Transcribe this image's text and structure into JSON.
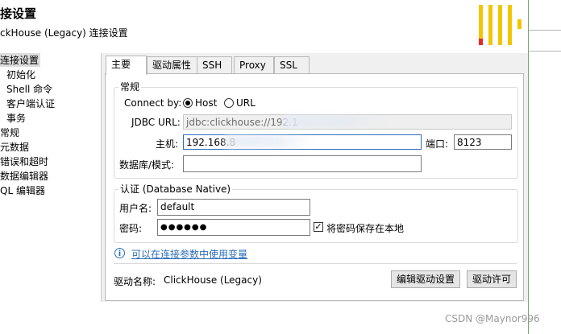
{
  "header": {
    "title": "接设置",
    "subtitle": "ckHouse (Legacy) 连接设置",
    "colors": {
      "logo_yellow": "#f3c500",
      "logo_red": "#e8262a"
    }
  },
  "tree": {
    "items": [
      {
        "label": "连接设置",
        "selected": true
      },
      {
        "label": "初始化"
      },
      {
        "label": "Shell 命令"
      },
      {
        "label": "客户端认证"
      },
      {
        "label": "事务"
      },
      {
        "label": "常规"
      },
      {
        "label": "元数据"
      },
      {
        "label": "错误和超时"
      },
      {
        "label": "数据编辑器"
      },
      {
        "label": "QL 编辑器"
      }
    ]
  },
  "tabs": [
    {
      "label": "主要",
      "active": true
    },
    {
      "label": "驱动属性"
    },
    {
      "label": "SSH"
    },
    {
      "label": "Proxy"
    },
    {
      "label": "SSL"
    }
  ],
  "general": {
    "group_label": "常规",
    "connect_by_label": "Connect by:",
    "host_option": "Host",
    "url_option": "URL",
    "jdbc_label": "JDBC URL:",
    "jdbc_value": "jdbc:clickhouse://192.1",
    "host_label": "主机:",
    "host_value": "192.168.8",
    "port_label": "端口:",
    "port_value": "8123",
    "database_label": "数据库/模式:",
    "database_value": ""
  },
  "auth": {
    "group_label": "认证 (Database Native)",
    "username_label": "用户名:",
    "username_value": "default",
    "password_label": "密码:",
    "password_value": "●●●●●●",
    "save_password_label": "将密码保存在本地",
    "save_password_checked": true
  },
  "info": {
    "icon": "info-icon",
    "link_text": "可以在连接参数中使用变量"
  },
  "driver": {
    "label": "驱动名称:",
    "value": "ClickHouse (Legacy)",
    "edit_button": "编辑驱动设置",
    "license_button": "驱动许可"
  },
  "watermark": "CSDN @Maynor996"
}
